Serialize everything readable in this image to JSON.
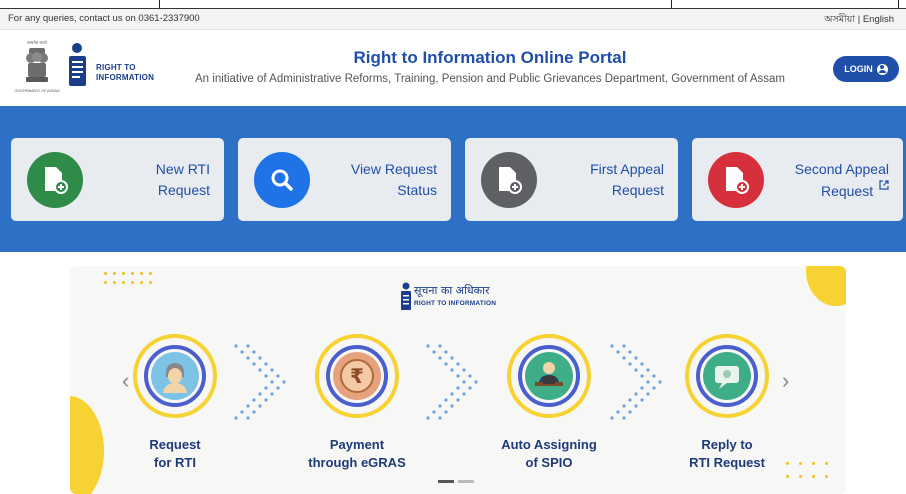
{
  "topbar": {
    "contact": "For any queries, contact us on 0361-2337900",
    "lang": "অসমীয়া | English"
  },
  "header": {
    "emblem_caption_top": "सत्यमेव जयते",
    "emblem_caption_bottom": "GOVERNMENT OF ASSAM",
    "logo_line1": "RIGHT TO",
    "logo_line2": "INFORMATION",
    "title": "Right to Information Online Portal",
    "subtitle": "An initiative of Administrative Reforms, Training, Pension and Public Grievances Department, Government of Assam",
    "login_label": "LOGIN"
  },
  "services": [
    {
      "line1": "New RTI",
      "line2": "Request",
      "icon": "file-add-icon",
      "color": "#2e8b48"
    },
    {
      "line1": "View Request",
      "line2": "Status",
      "icon": "search-icon",
      "color": "#1f73e6"
    },
    {
      "line1": "First Appeal",
      "line2": "Request",
      "icon": "file-add-icon",
      "color": "#5e6063"
    },
    {
      "line1": "Second Appeal",
      "line2": "Request",
      "icon": "file-add-icon",
      "color": "#d6303c",
      "external": true
    }
  ],
  "carousel": {
    "brand_hi": "सूचना का अधिकार",
    "brand_en": "RIGHT TO INFORMATION",
    "steps": [
      {
        "line1": "Request",
        "line2": "for RTI",
        "icon": "person-icon"
      },
      {
        "line1": "Payment",
        "line2": "through eGRAS",
        "icon": "rupee-coin-icon"
      },
      {
        "line1": "Auto Assigning",
        "line2": "of SPIO",
        "icon": "officer-desk-icon"
      },
      {
        "line1": "Reply to",
        "line2": "RTI Request",
        "icon": "chat-bubble-icon"
      }
    ],
    "prev": "‹",
    "next": "›"
  },
  "colors": {
    "brand_blue": "#1f4fa8",
    "band_blue": "#2e70c6",
    "accent_yellow": "#f6d232"
  }
}
